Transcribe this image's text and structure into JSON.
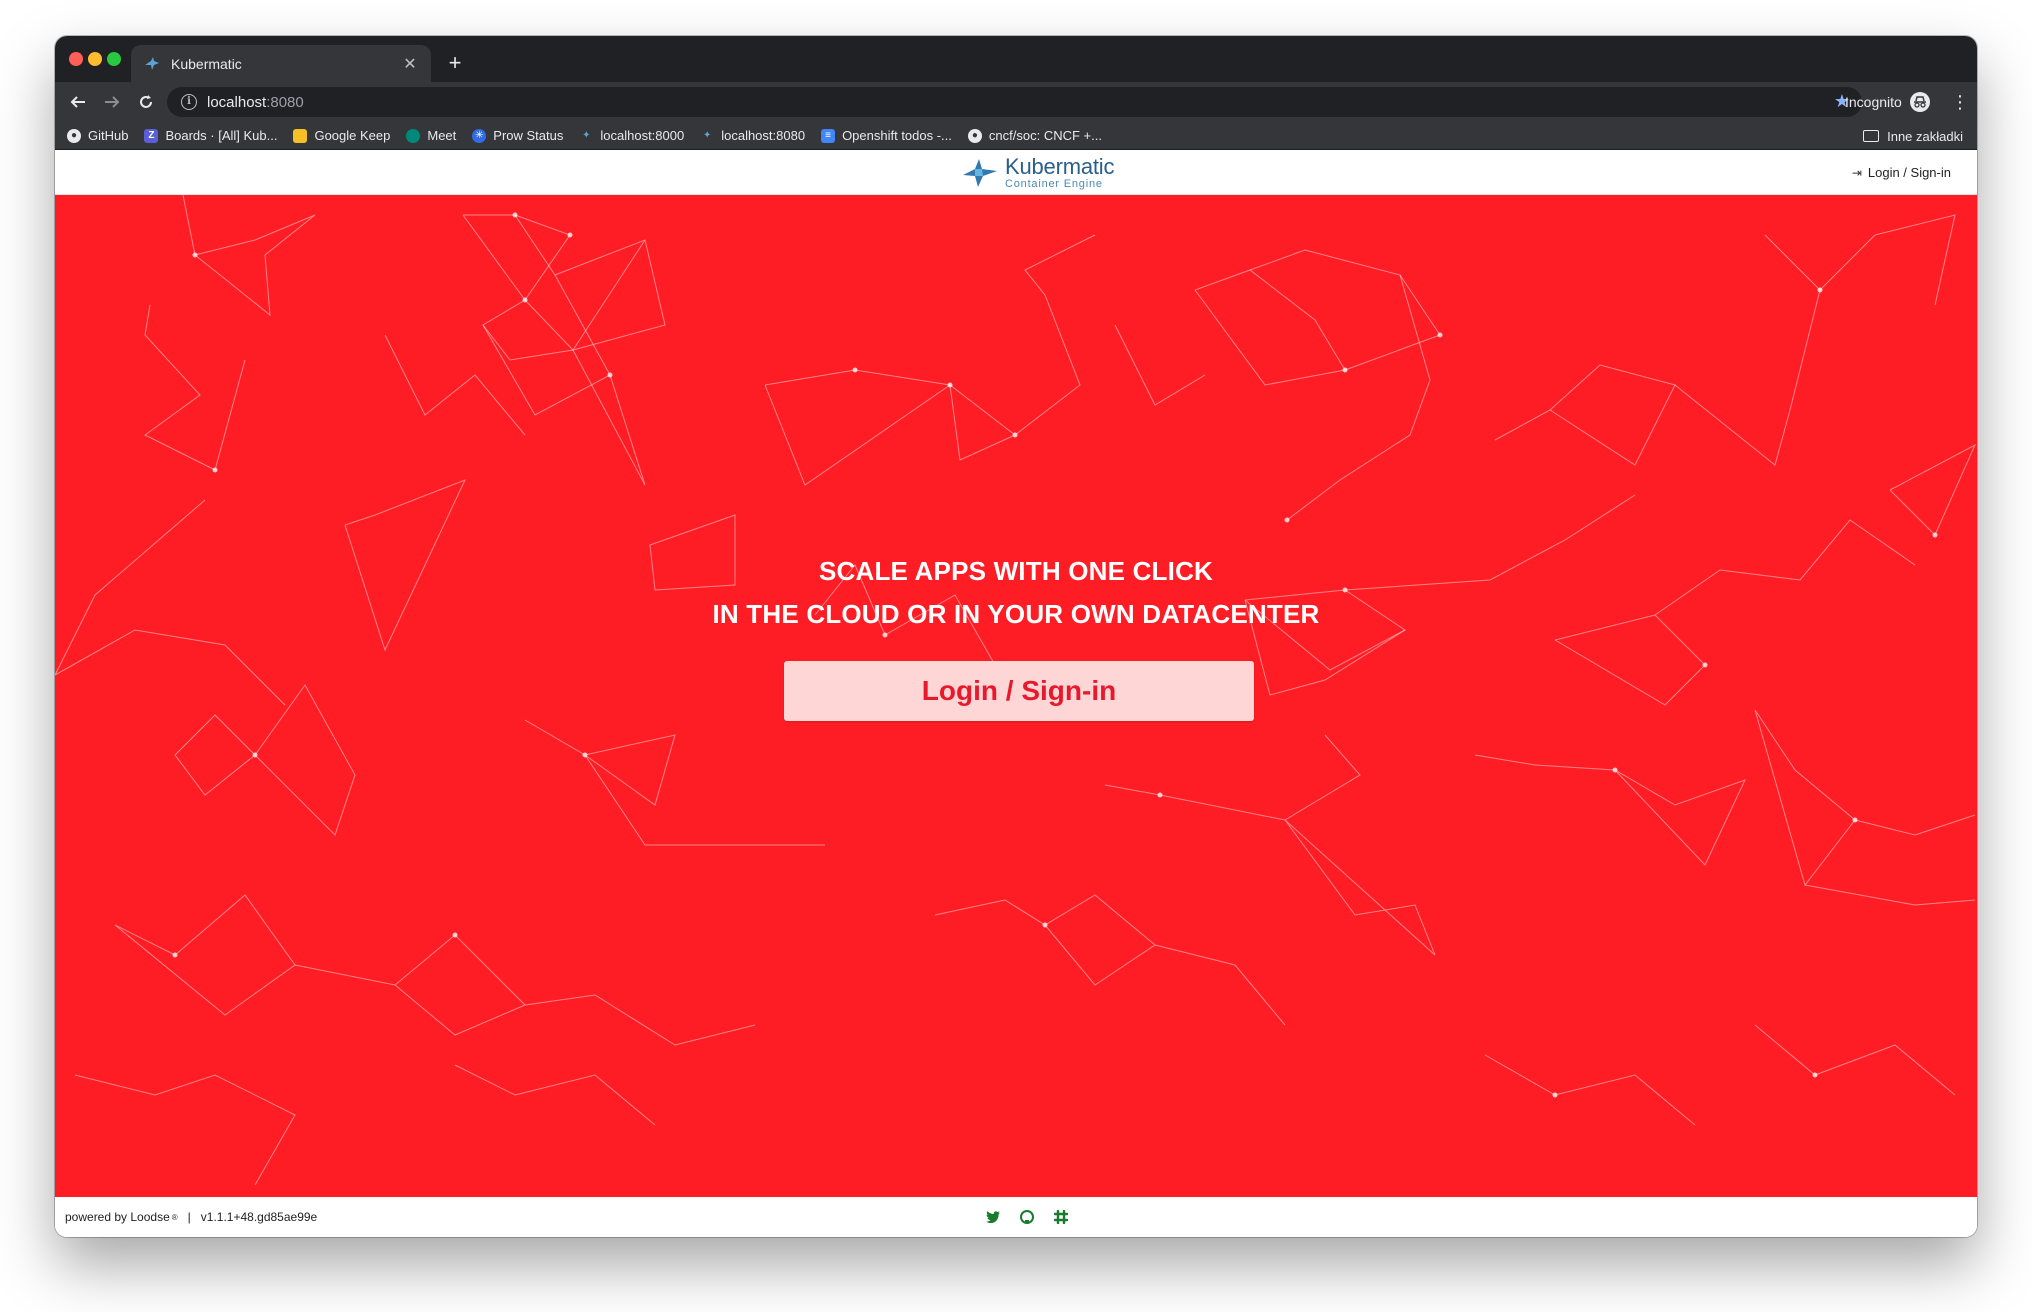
{
  "browser": {
    "tab_title": "Kubermatic",
    "tab_close": "✕",
    "new_tab": "+",
    "url_host": "localhost",
    "url_port": ":8080",
    "profile_label": "Incognito",
    "bookmarks": [
      {
        "label": "GitHub",
        "icon": "github-icon"
      },
      {
        "label": "Boards · [All] Kub...",
        "icon": "zenhub-icon"
      },
      {
        "label": "Google Keep",
        "icon": "keep-icon"
      },
      {
        "label": "Meet",
        "icon": "meet-icon"
      },
      {
        "label": "Prow Status",
        "icon": "kubernetes-icon"
      },
      {
        "label": "localhost:8000",
        "icon": "kubermatic-icon"
      },
      {
        "label": "localhost:8080",
        "icon": "kubermatic-icon"
      },
      {
        "label": "Openshift todos -...",
        "icon": "docs-icon"
      },
      {
        "label": "cncf/soc: CNCF +...",
        "icon": "github-icon"
      }
    ],
    "other_bookmarks": "Inne zakładki"
  },
  "header": {
    "brand_name": "Kubermatic",
    "brand_sub": "Container Engine",
    "login_label": "Login / Sign-in"
  },
  "hero": {
    "line1": "SCALE APPS WITH ONE CLICK",
    "line2": "IN THE CLOUD OR IN YOUR OWN DATACENTER",
    "cta_label": "Login / Sign-in",
    "background_color": "#ff1d25"
  },
  "footer": {
    "powered_by": "powered by Loodse",
    "registered": "®",
    "separator": "|",
    "version": "v1.1.1+48.gd85ae99e",
    "social_icons": [
      "twitter-icon",
      "github-icon",
      "slack-icon"
    ]
  }
}
